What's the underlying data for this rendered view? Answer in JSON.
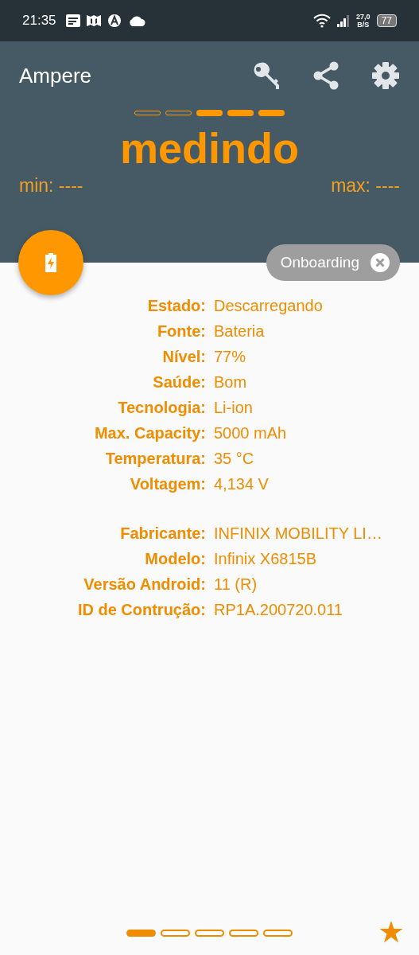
{
  "status_bar": {
    "time": "21:35",
    "speed_value": "27,0",
    "speed_unit": "B/S",
    "battery": "77"
  },
  "app_bar": {
    "title": "Ampere"
  },
  "level_indicator": [
    {
      "filled": false
    },
    {
      "filled": false
    },
    {
      "filled": true
    },
    {
      "filled": true
    },
    {
      "filled": true
    }
  ],
  "reading": "medindo",
  "min": "min: ----",
  "max": "max: ----",
  "chip": {
    "label": "Onboarding"
  },
  "info_groups": [
    [
      {
        "label": "Estado:",
        "value": "Descarregando"
      },
      {
        "label": "Fonte:",
        "value": "Bateria"
      },
      {
        "label": "Nível:",
        "value": "77%"
      },
      {
        "label": "Saúde:",
        "value": "Bom"
      },
      {
        "label": "Tecnologia:",
        "value": "Li-ion"
      },
      {
        "label": "Max. Capacity:",
        "value": "5000 mAh"
      },
      {
        "label": "Temperatura:",
        "value": "35 °C"
      },
      {
        "label": "Voltagem:",
        "value": "4,134 V"
      }
    ],
    [
      {
        "label": "Fabricante:",
        "value": "INFINIX MOBILITY LI…"
      },
      {
        "label": "Modelo:",
        "value": "Infinix X6815B"
      },
      {
        "label": "Versão Android:",
        "value": "11 (R)"
      },
      {
        "label": "ID de Contrução:",
        "value": "RP1A.200720.011"
      }
    ]
  ],
  "pager": [
    {
      "selected": true
    },
    {
      "selected": false
    },
    {
      "selected": false
    },
    {
      "selected": false
    },
    {
      "selected": false
    }
  ]
}
